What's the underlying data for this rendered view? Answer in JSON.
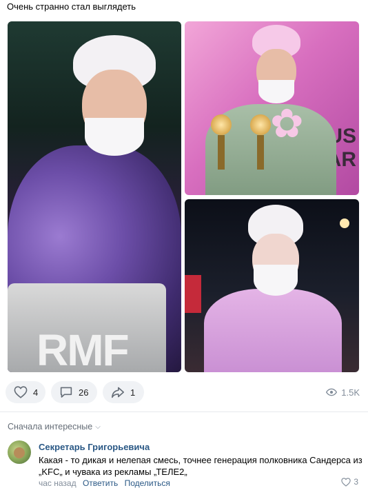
{
  "post": {
    "text": "Очень странно стал выглядеть",
    "photos": {
      "main_logo": "RMF",
      "award_text": "US\nAR"
    }
  },
  "actions": {
    "likes": "4",
    "comments": "26",
    "shares": "1",
    "views": "1.5K"
  },
  "comments_section": {
    "sort_label": "Сначала интересные",
    "comment": {
      "author": "Секретарь Григорьевича",
      "text": "Какая - то дикая и нелепая смесь, точнее генерация полковника Сандерса из „KFC„ и чувака из рекламы „ТЕЛЕ2„",
      "time": "час назад",
      "reply_label": "Ответить",
      "share_label": "Поделиться",
      "likes": "3"
    }
  },
  "icons": {
    "like": "heart-icon",
    "comment": "comment-icon",
    "share": "share-arrow-icon",
    "views": "eye-icon",
    "sort": "chevron-down-icon"
  },
  "colors": {
    "link": "#2a5885",
    "muted": "#818c99",
    "pill_bg": "#f0f2f5"
  }
}
